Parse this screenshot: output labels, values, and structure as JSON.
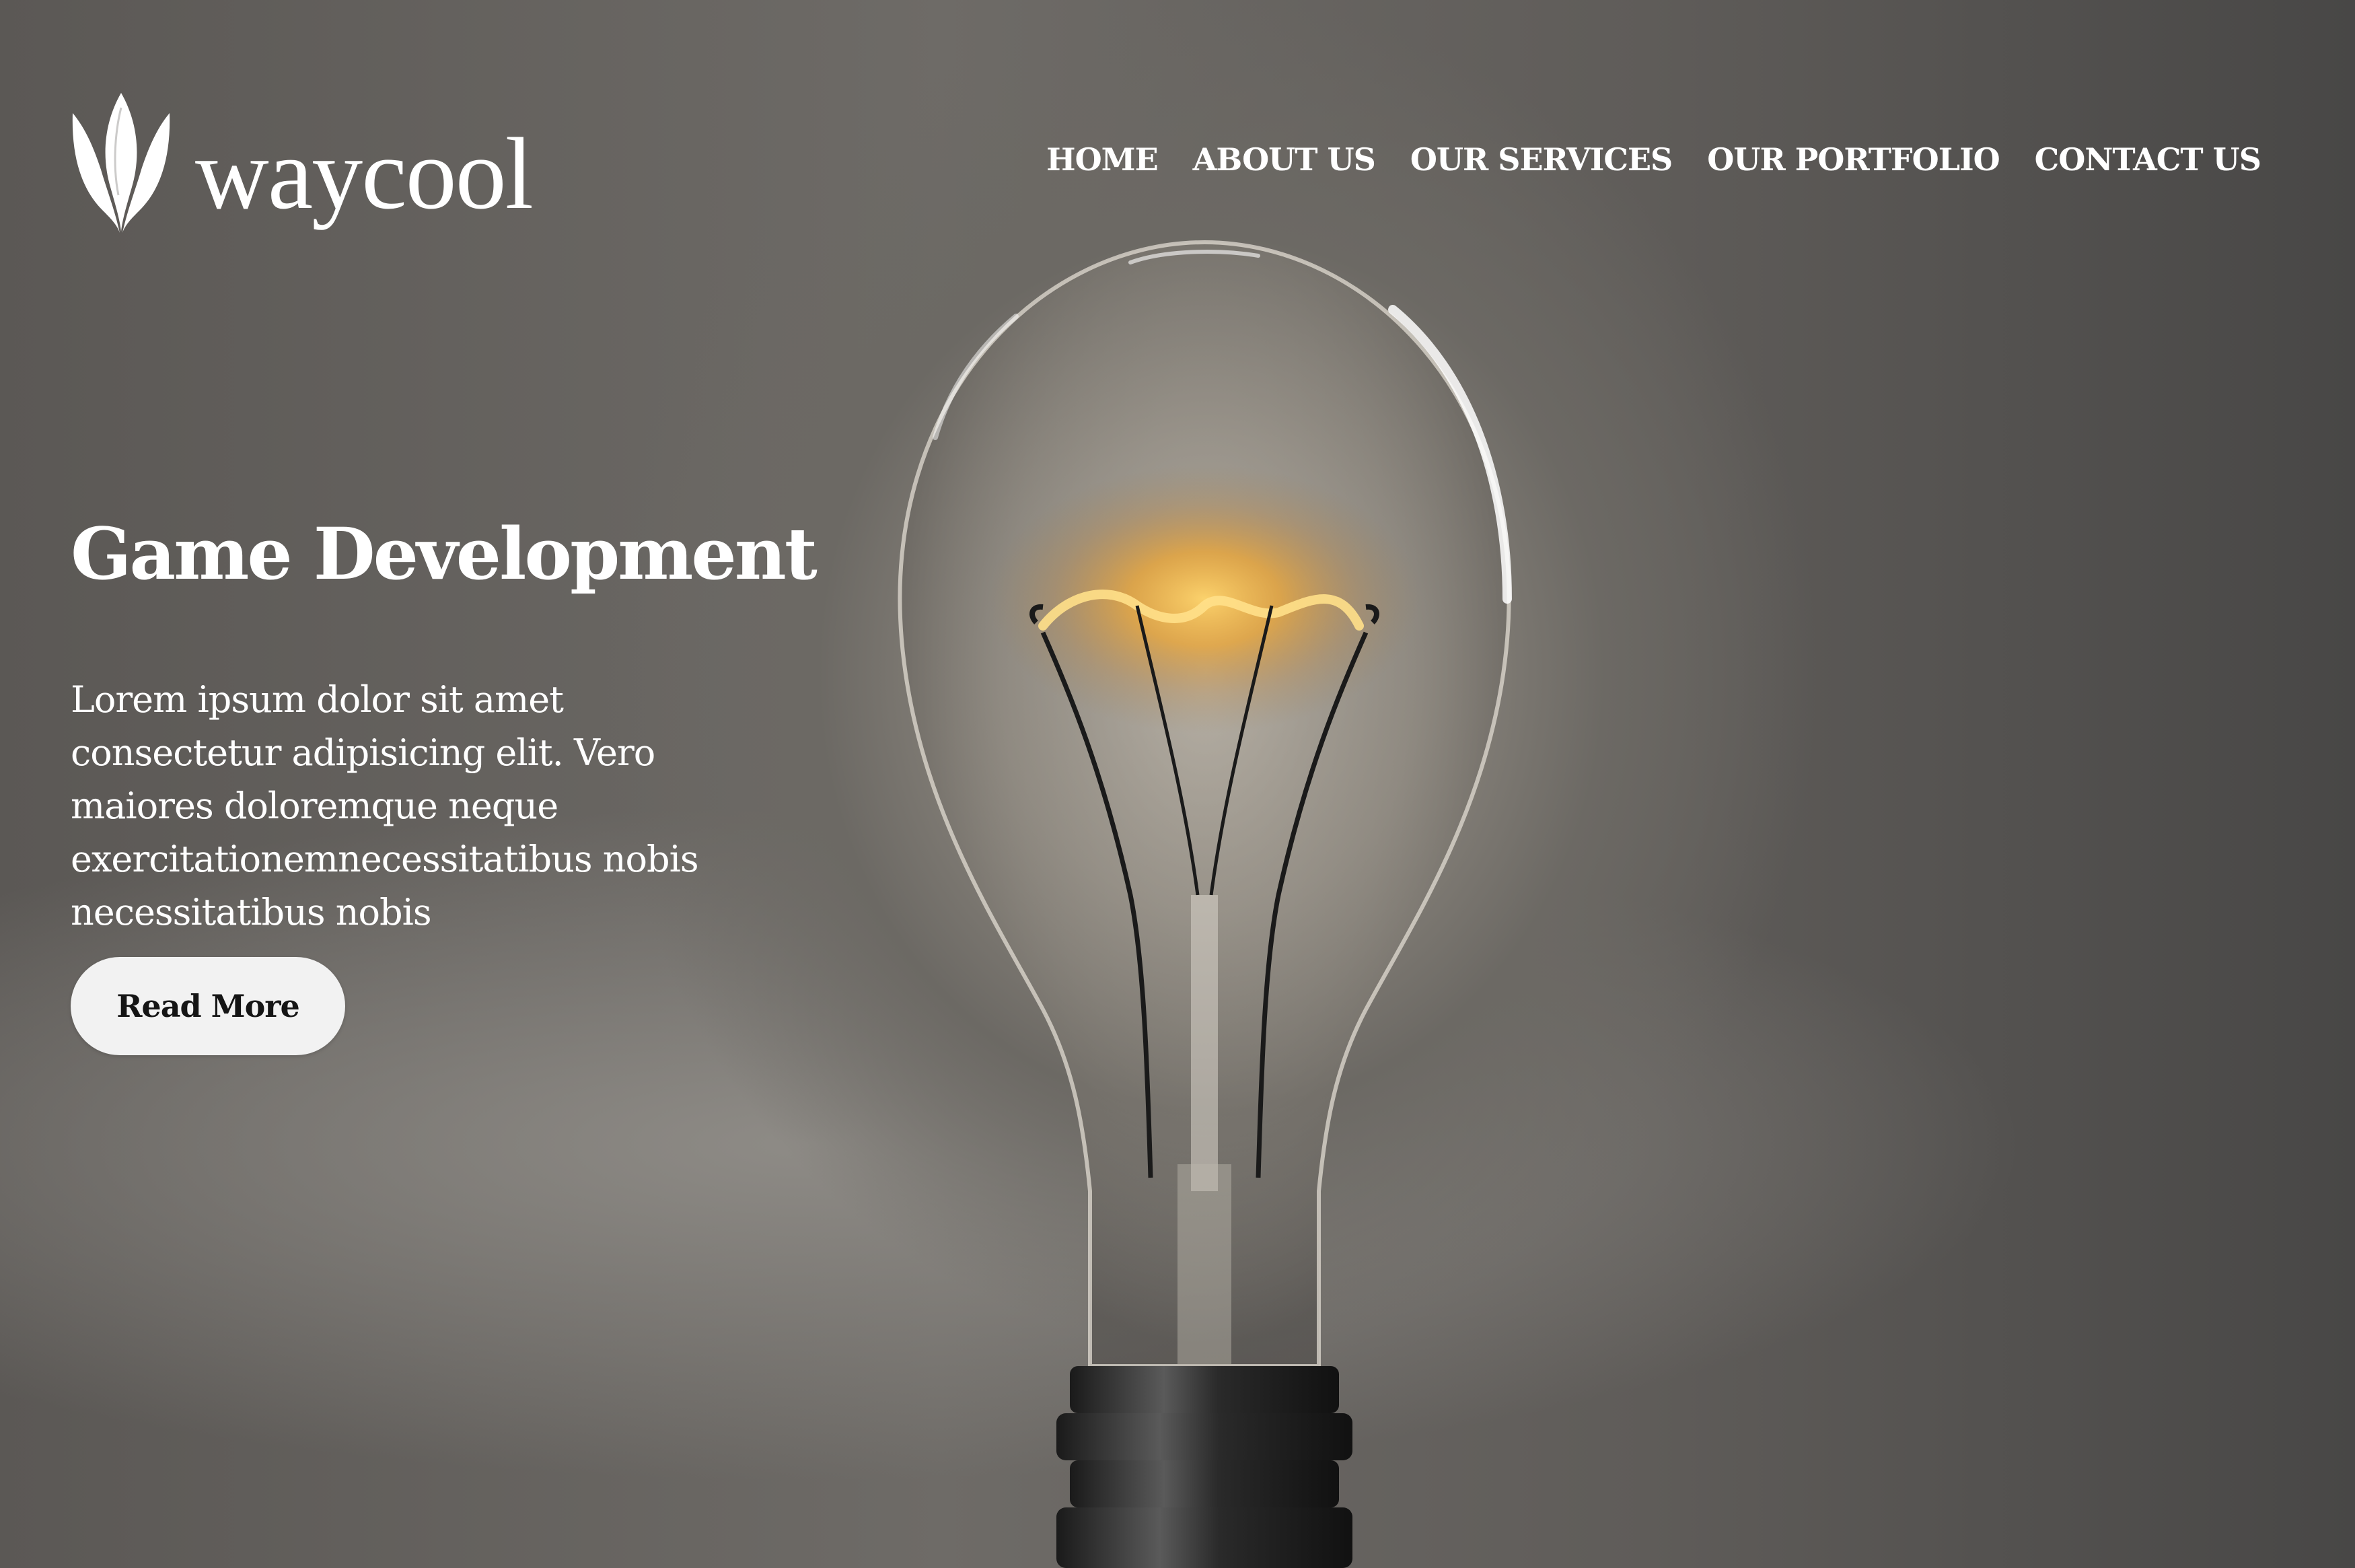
{
  "brand": {
    "name": "waycool"
  },
  "nav": {
    "items": [
      {
        "label": "HOME"
      },
      {
        "label": "ABOUT US"
      },
      {
        "label": "OUR SERVICES"
      },
      {
        "label": "OUR PORTFOLIO"
      },
      {
        "label": "CONTACT US"
      }
    ]
  },
  "hero": {
    "title": "Game Development",
    "description": "Lorem ipsum dolor sit amet consectetur adipisicing elit. Vero maiores doloremque neque exercitationemnecessitatibus nobis necessitatibus nobis",
    "cta_label": "Read More"
  },
  "colors": {
    "text": "#ffffff",
    "button_bg": "#f2f2f2",
    "button_text": "#151515",
    "filament_glow": "#f6b52a"
  },
  "icons": {
    "logo": "leaf-logo-icon",
    "hero_image": "lightbulb-illustration"
  }
}
